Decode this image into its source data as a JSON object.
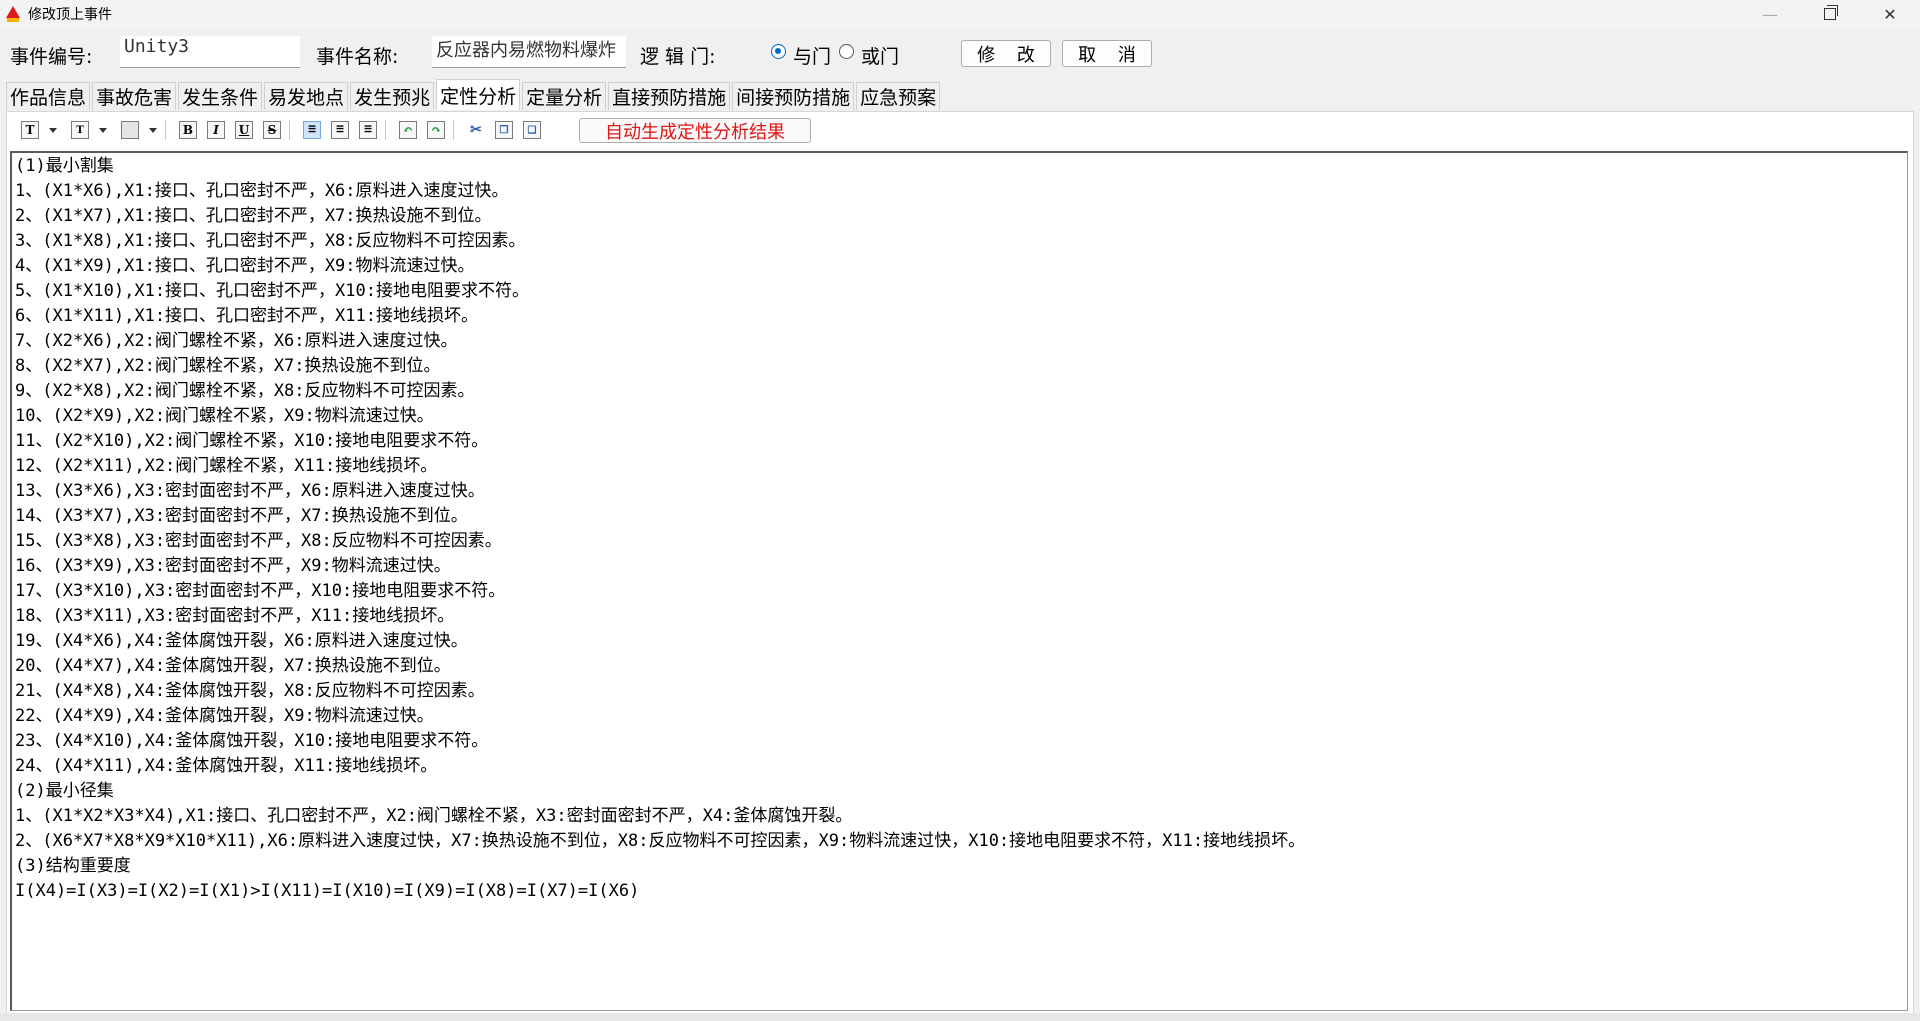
{
  "window": {
    "title": "修改顶上事件"
  },
  "form": {
    "event_id_label": "事件编号:",
    "event_id_value": "Unity3",
    "event_name_label": "事件名称:",
    "event_name_value": "反应器内易燃物料爆炸",
    "logic_gate_label": "逻 辑 门:",
    "and_gate_label": "与门",
    "or_gate_label": "或门",
    "selected_gate": "与门",
    "modify_label": "修 改",
    "cancel_label": "取 消"
  },
  "tabs": [
    {
      "label": "作品信息"
    },
    {
      "label": "事故危害"
    },
    {
      "label": "发生条件"
    },
    {
      "label": "易发地点"
    },
    {
      "label": "发生预兆"
    },
    {
      "label": "定性分析",
      "active": true
    },
    {
      "label": "定量分析"
    },
    {
      "label": "直接预防措施"
    },
    {
      "label": "间接预防措施"
    },
    {
      "label": "应急预案"
    }
  ],
  "toolbar": {
    "icons": [
      "font-icon",
      "font-size-icon",
      "highlight-color-icon",
      "bold-icon",
      "italic-icon",
      "underline-icon",
      "strikethrough-icon",
      "align-left-icon",
      "align-center-icon",
      "align-right-icon",
      "undo-icon",
      "redo-icon",
      "cut-icon",
      "copy-icon",
      "paste-icon"
    ],
    "generate_label": "自动生成定性分析结果"
  },
  "editor": {
    "lines": [
      "(1)最小割集",
      "1、(X1*X6),X1:接口、孔口密封不严，X6:原料进入速度过快。",
      "2、(X1*X7),X1:接口、孔口密封不严，X7:换热设施不到位。",
      "3、(X1*X8),X1:接口、孔口密封不严，X8:反应物料不可控因素。",
      "4、(X1*X9),X1:接口、孔口密封不严，X9:物料流速过快。",
      "5、(X1*X10),X1:接口、孔口密封不严，X10:接地电阻要求不符。",
      "6、(X1*X11),X1:接口、孔口密封不严，X11:接地线损坏。",
      "7、(X2*X6),X2:阀门螺栓不紧，X6:原料进入速度过快。",
      "8、(X2*X7),X2:阀门螺栓不紧，X7:换热设施不到位。",
      "9、(X2*X8),X2:阀门螺栓不紧，X8:反应物料不可控因素。",
      "10、(X2*X9),X2:阀门螺栓不紧，X9:物料流速过快。",
      "11、(X2*X10),X2:阀门螺栓不紧，X10:接地电阻要求不符。",
      "12、(X2*X11),X2:阀门螺栓不紧，X11:接地线损坏。",
      "13、(X3*X6),X3:密封面密封不严，X6:原料进入速度过快。",
      "14、(X3*X7),X3:密封面密封不严，X7:换热设施不到位。",
      "15、(X3*X8),X3:密封面密封不严，X8:反应物料不可控因素。",
      "16、(X3*X9),X3:密封面密封不严，X9:物料流速过快。",
      "17、(X3*X10),X3:密封面密封不严，X10:接地电阻要求不符。",
      "18、(X3*X11),X3:密封面密封不严，X11:接地线损坏。",
      "19、(X4*X6),X4:釜体腐蚀开裂，X6:原料进入速度过快。",
      "20、(X4*X7),X4:釜体腐蚀开裂，X7:换热设施不到位。",
      "21、(X4*X8),X4:釜体腐蚀开裂，X8:反应物料不可控因素。",
      "22、(X4*X9),X4:釜体腐蚀开裂，X9:物料流速过快。",
      "23、(X4*X10),X4:釜体腐蚀开裂，X10:接地电阻要求不符。",
      "24、(X4*X11),X4:釜体腐蚀开裂，X11:接地线损坏。",
      "(2)最小径集",
      "1、(X1*X2*X3*X4),X1:接口、孔口密封不严，X2:阀门螺栓不紧，X3:密封面密封不严，X4:釜体腐蚀开裂。",
      "2、(X6*X7*X8*X9*X10*X11),X6:原料进入速度过快，X7:换热设施不到位，X8:反应物料不可控因素，X9:物料流速过快，X10:接地电阻要求不符，X11:接地线损坏。",
      "(3)结构重要度",
      "I(X4)=I(X3)=I(X2)=I(X1)>I(X11)=I(X10)=I(X9)=I(X8)=I(X7)=I(X6)"
    ]
  },
  "colors": {
    "accent_blue": "#0066cc",
    "generate_text_red": "#e01515"
  }
}
